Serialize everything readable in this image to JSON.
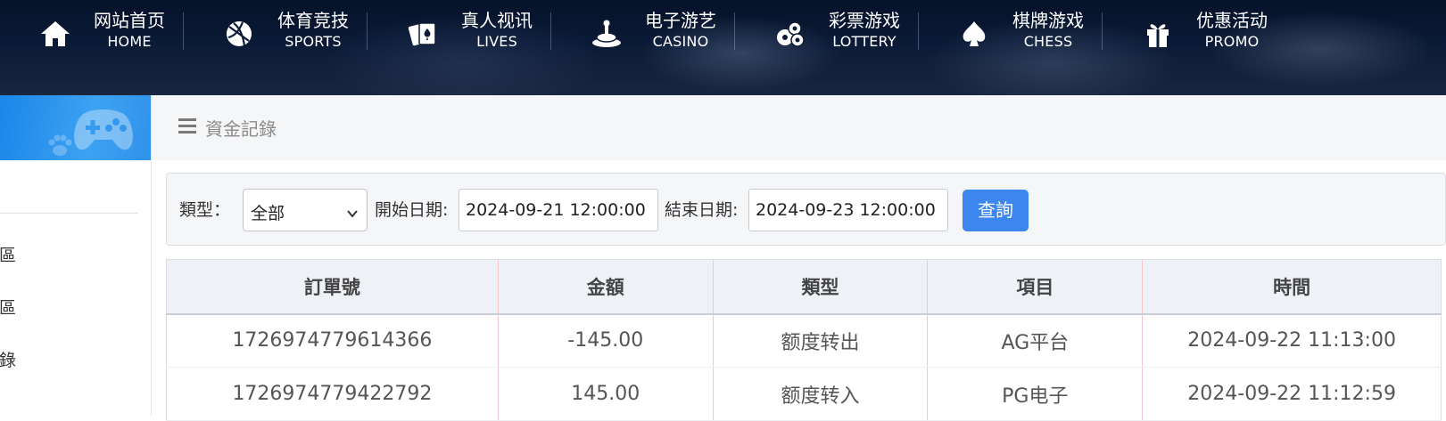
{
  "nav": {
    "items": [
      {
        "cn": "网站首页",
        "en": "HOME",
        "icon": "home-icon"
      },
      {
        "cn": "体育竞技",
        "en": "SPORTS",
        "icon": "ball-icon"
      },
      {
        "cn": "真人视讯",
        "en": "LIVES",
        "icon": "cards-icon"
      },
      {
        "cn": "电子游艺",
        "en": "CASINO",
        "icon": "slot-icon"
      },
      {
        "cn": "彩票游戏",
        "en": "LOTTERY",
        "icon": "lottery-balls-icon"
      },
      {
        "cn": "棋牌游戏",
        "en": "CHESS",
        "icon": "spade-icon"
      },
      {
        "cn": "优惠活动",
        "en": "PROMO",
        "icon": "gift-icon"
      }
    ]
  },
  "sidebar": {
    "banner_icon": "gamepad-icon",
    "items": [
      "專區",
      "專區",
      "記錄",
      "錄"
    ]
  },
  "header": {
    "title": "資金記錄",
    "menu_icon": "menu-icon"
  },
  "filter": {
    "type_label": "類型：",
    "type_value": "全部",
    "start_label": "開始日期:",
    "start_value": "2024-09-21 12:00:00",
    "end_label": "結束日期:",
    "end_value": "2024-09-23 12:00:00",
    "query_label": "查詢"
  },
  "table": {
    "headers": [
      "訂單號",
      "金額",
      "類型",
      "項目",
      "時間"
    ],
    "rows": [
      [
        "1726974779614366",
        "-145.00",
        "额度转出",
        "AG平台",
        "2024-09-22 11:13:00"
      ],
      [
        "1726974779422792",
        "145.00",
        "额度转入",
        "PG电子",
        "2024-09-22 11:12:59"
      ]
    ]
  },
  "colors": {
    "accent": "#3d86f0",
    "banner": "#2a92ec"
  }
}
